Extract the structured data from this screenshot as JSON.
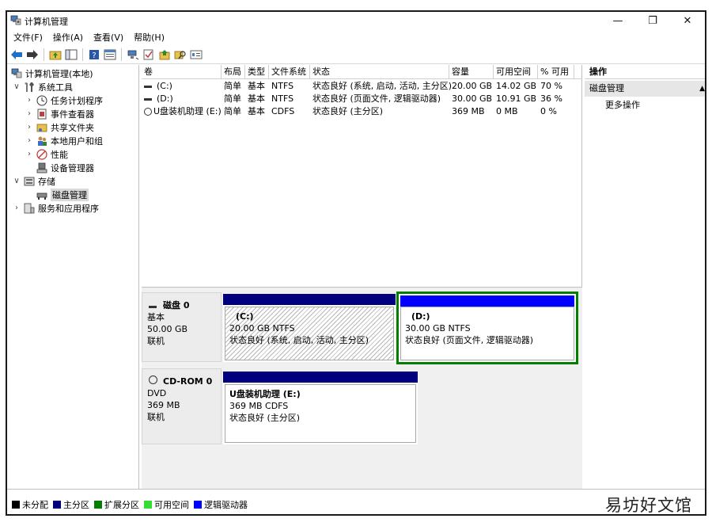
{
  "window": {
    "title": "计算机管理",
    "minimize_glyph": "—",
    "maximize_glyph": "❐",
    "close_glyph": "✕"
  },
  "menu": [
    "文件(F)",
    "操作(A)",
    "查看(V)",
    "帮助(H)"
  ],
  "toolbar_icons": [
    "back-arrow-icon",
    "forward-arrow-icon",
    "up-folder-icon",
    "console-tree-icon",
    "help-icon",
    "properties-icon",
    "connect-icon",
    "check-icon",
    "export-icon",
    "search-icon",
    "list-icon"
  ],
  "tree": {
    "root": "计算机管理(本地)",
    "system_tools": "系统工具",
    "task_scheduler": "任务计划程序",
    "event_viewer": "事件查看器",
    "shared_folders": "共享文件夹",
    "local_users": "本地用户和组",
    "performance": "性能",
    "device_manager": "设备管理器",
    "storage": "存储",
    "disk_management": "磁盘管理",
    "services_apps": "服务和应用程序"
  },
  "volumes": {
    "columns": [
      "卷",
      "布局",
      "类型",
      "文件系统",
      "状态",
      "容量",
      "可用空间",
      "% 可用"
    ],
    "rows": [
      [
        "(C:)",
        "简单",
        "基本",
        "NTFS",
        "状态良好 (系统, 启动, 活动, 主分区)",
        "20.00 GB",
        "14.02 GB",
        "70 %"
      ],
      [
        "(D:)",
        "简单",
        "基本",
        "NTFS",
        "状态良好 (页面文件, 逻辑驱动器)",
        "30.00 GB",
        "10.91 GB",
        "36 %"
      ],
      [
        "U盘装机助理 (E:)",
        "简单",
        "基本",
        "CDFS",
        "状态良好 (主分区)",
        "369 MB",
        "0 MB",
        "0 %"
      ]
    ]
  },
  "disks": [
    {
      "name": "磁盘 0",
      "type": "基本",
      "size": "50.00 GB",
      "status": "联机",
      "partitions": [
        {
          "name": "(C:)",
          "size": "20.00 GB NTFS",
          "status": "状态良好 (系统, 启动, 活动, 主分区)"
        },
        {
          "name": "(D:)",
          "size": "30.00 GB NTFS",
          "status": "状态良好 (页面文件, 逻辑驱动器)"
        }
      ]
    },
    {
      "name": "CD-ROM 0",
      "type": "DVD",
      "size": "369 MB",
      "status": "联机",
      "partitions": [
        {
          "name": "U盘装机助理  (E:)",
          "size": "369 MB CDFS",
          "status": "状态良好 (主分区)"
        }
      ]
    }
  ],
  "legend": [
    {
      "label": "未分配",
      "color": "#000000"
    },
    {
      "label": "主分区",
      "color": "#00007f"
    },
    {
      "label": "扩展分区",
      "color": "#007f00"
    },
    {
      "label": "可用空间",
      "color": "#33dd33"
    },
    {
      "label": "逻辑驱动器",
      "color": "#0000ff"
    }
  ],
  "actions": {
    "header": "操作",
    "section": "磁盘管理",
    "more": "更多操作"
  },
  "colors": {
    "primary_bar": "#00007f",
    "logical_bar": "#0000ff",
    "extended_border": "#007f00"
  },
  "watermark": "易坊好文馆"
}
